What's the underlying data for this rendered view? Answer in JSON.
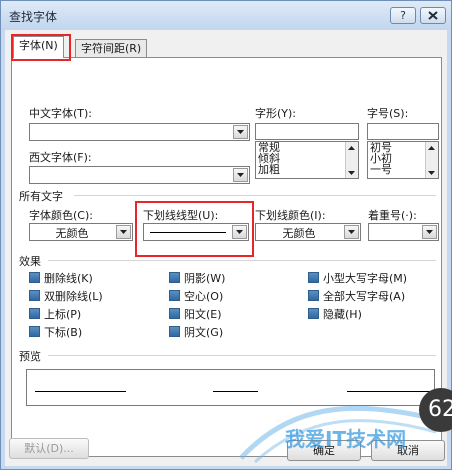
{
  "window": {
    "title": "查找字体",
    "help_label": "?"
  },
  "tabs": [
    {
      "label": "字体(N)",
      "active": true
    },
    {
      "label": "字符间距(R)",
      "active": false
    }
  ],
  "font": {
    "chinese_font_label": "中文字体(T):",
    "chinese_font_value": "",
    "western_font_label": "西文字体(F):",
    "western_font_value": "",
    "style_label": "字形(Y):",
    "style_value": "",
    "style_options": [
      "常规",
      "倾斜",
      "加粗"
    ],
    "size_label": "字号(S):",
    "size_value": "",
    "size_options": [
      "初号",
      "小初",
      "一号"
    ]
  },
  "all_text": {
    "section_label": "所有文字",
    "font_color_label": "字体颜色(C):",
    "font_color_value": "无颜色",
    "underline_type_label": "下划线线型(U):",
    "underline_color_label": "下划线颜色(I):",
    "underline_color_value": "无颜色",
    "emphasis_label": "着重号(·):",
    "emphasis_value": ""
  },
  "effects": {
    "section_label": "效果",
    "items": [
      "删除线(K)",
      "双删除线(L)",
      "上标(P)",
      "下标(B)",
      "阴影(W)",
      "空心(O)",
      "阳文(E)",
      "阴文(G)",
      "小型大写字母(M)",
      "全部大写字母(A)",
      "隐藏(H)"
    ]
  },
  "preview": {
    "section_label": "预览"
  },
  "buttons": {
    "default_label": "默认(D)...",
    "ok_label": "确定",
    "cancel_label": "取消"
  },
  "overlay": {
    "watermark_text": "我爱IT技术网",
    "badge_text": "62"
  },
  "colors": {
    "highlight_box": "#e8262a",
    "title_bar": "#c7d9ee",
    "checkbox": "#2f6aa3"
  }
}
